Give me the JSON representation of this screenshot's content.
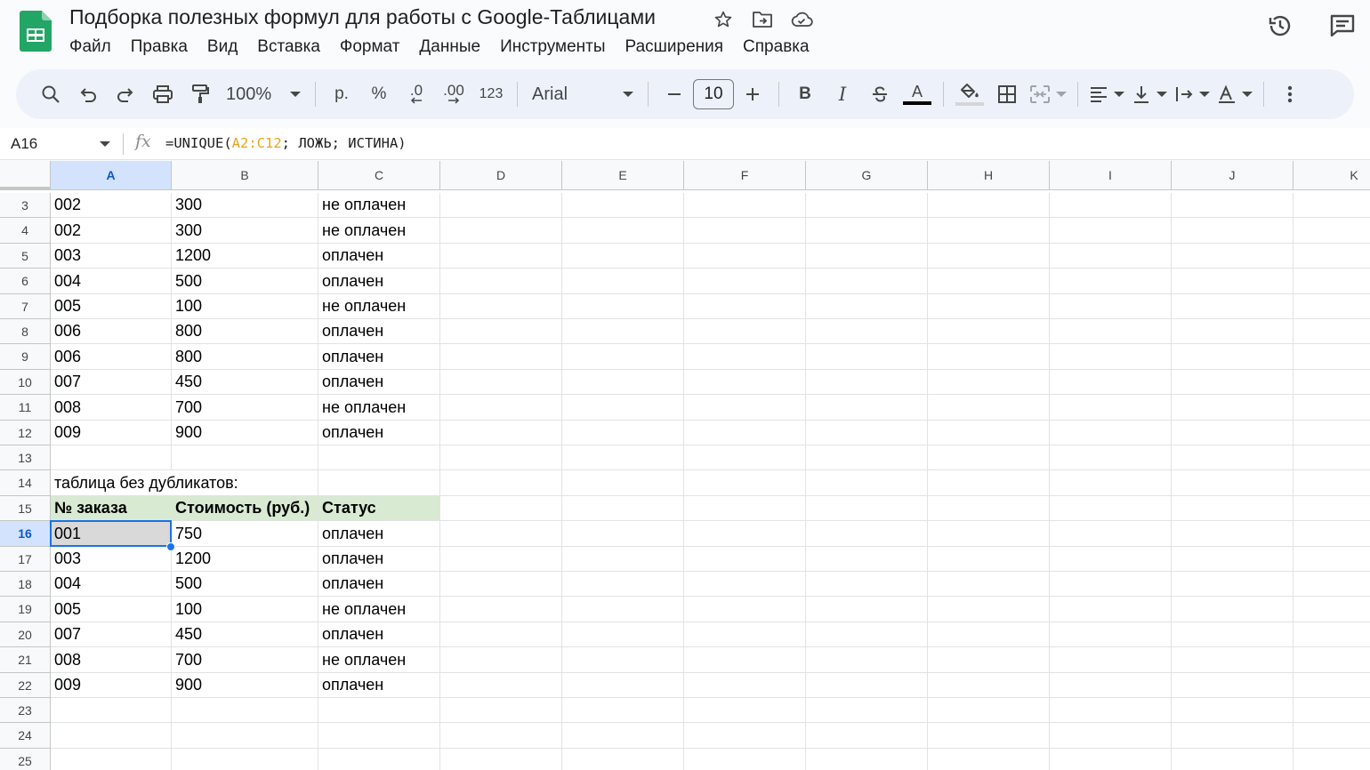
{
  "doc": {
    "title": "Подборка полезных формул для работы с Google-Таблицами"
  },
  "menu": [
    "Файл",
    "Правка",
    "Вид",
    "Вставка",
    "Формат",
    "Данные",
    "Инструменты",
    "Расширения",
    "Справка"
  ],
  "toolbar": {
    "zoom": "100%",
    "currency": "р.",
    "percent": "%",
    "decrease_decimal": ".0",
    "increase_decimal": ".00",
    "number_format": "123",
    "font": "Arial",
    "font_size": "10",
    "bold": "B",
    "italic": "I",
    "text_color_letter": "A",
    "text_color": "#000000",
    "accent": "#0b57d0"
  },
  "formula_bar": {
    "cell_ref": "A16",
    "fx": "fx",
    "prefix": "=UNIQUE(",
    "range": "A2:C12",
    "suffix": "; ЛОЖЬ; ИСТИНА)"
  },
  "sheet": {
    "columns": [
      "A",
      "B",
      "C",
      "D",
      "E",
      "F",
      "G",
      "H",
      "I",
      "J",
      "K"
    ],
    "selected_cell": "A16",
    "rows": [
      {
        "num": "3",
        "cells": [
          "002",
          "300",
          "не оплачен"
        ]
      },
      {
        "num": "4",
        "cells": [
          "002",
          "300",
          "не оплачен"
        ]
      },
      {
        "num": "5",
        "cells": [
          "003",
          "1200",
          "оплачен"
        ]
      },
      {
        "num": "6",
        "cells": [
          "004",
          "500",
          "оплачен"
        ]
      },
      {
        "num": "7",
        "cells": [
          "005",
          "100",
          "не оплачен"
        ]
      },
      {
        "num": "8",
        "cells": [
          "006",
          "800",
          "оплачен"
        ]
      },
      {
        "num": "9",
        "cells": [
          "006",
          "800",
          "оплачен"
        ]
      },
      {
        "num": "10",
        "cells": [
          "007",
          "450",
          "оплачен"
        ]
      },
      {
        "num": "11",
        "cells": [
          "008",
          "700",
          "не оплачен"
        ]
      },
      {
        "num": "12",
        "cells": [
          "009",
          "900",
          "оплачен"
        ]
      },
      {
        "num": "13",
        "cells": [
          "",
          "",
          ""
        ]
      },
      {
        "num": "14",
        "cells": [
          "таблица без дубликатов:",
          "",
          ""
        ]
      },
      {
        "num": "15",
        "cells": [
          "№ заказа",
          "Стоимость (руб.)",
          "Статус"
        ],
        "header": true
      },
      {
        "num": "16",
        "cells": [
          "001",
          "750",
          "оплачен"
        ]
      },
      {
        "num": "17",
        "cells": [
          "003",
          "1200",
          "оплачен"
        ]
      },
      {
        "num": "18",
        "cells": [
          "004",
          "500",
          "оплачен"
        ]
      },
      {
        "num": "19",
        "cells": [
          "005",
          "100",
          "не оплачен"
        ]
      },
      {
        "num": "20",
        "cells": [
          "007",
          "450",
          "оплачен"
        ]
      },
      {
        "num": "21",
        "cells": [
          "008",
          "700",
          "не оплачен"
        ]
      },
      {
        "num": "22",
        "cells": [
          "009",
          "900",
          "оплачен"
        ]
      },
      {
        "num": "23",
        "cells": [
          "",
          "",
          ""
        ]
      },
      {
        "num": "24",
        "cells": [
          "",
          "",
          ""
        ]
      },
      {
        "num": "25",
        "cells": [
          "",
          "",
          ""
        ]
      }
    ],
    "header_fill": "#d9ead3",
    "selection_color": "#1a73e8"
  }
}
